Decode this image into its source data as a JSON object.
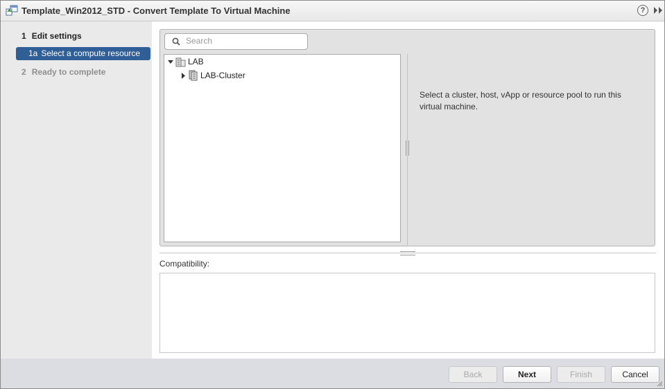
{
  "window": {
    "title": "Template_Win2012_STD - Convert Template To Virtual Machine",
    "help_glyph": "?",
    "icons": {
      "title": "template-convert-icon",
      "help": "help-icon",
      "expand": "double-chevron-right-icon"
    }
  },
  "nav": {
    "steps": [
      {
        "num": "1",
        "label": "Edit settings",
        "state": "active-group"
      },
      {
        "num": "1a",
        "label": "Select a compute resource",
        "state": "selected"
      },
      {
        "num": "2",
        "label": "Ready to complete",
        "state": "disabled"
      }
    ]
  },
  "search": {
    "placeholder": "Search",
    "value": ""
  },
  "tree": {
    "items": [
      {
        "label": "LAB",
        "icon": "datacenter-icon",
        "expanded": true
      },
      {
        "label": "LAB-Cluster",
        "icon": "cluster-icon",
        "expanded": false
      }
    ]
  },
  "info": {
    "text": "Select a cluster, host, vApp or resource pool to run this virtual machine."
  },
  "compatibility": {
    "label": "Compatibility:"
  },
  "buttons": {
    "back": "Back",
    "next": "Next",
    "finish": "Finish",
    "cancel": "Cancel"
  },
  "colors": {
    "selected_step_bg": "#2f5f96",
    "nav_bg": "#eaeaea",
    "panel_bg": "#e2e2e2",
    "footer_bg": "#dcdde3"
  }
}
